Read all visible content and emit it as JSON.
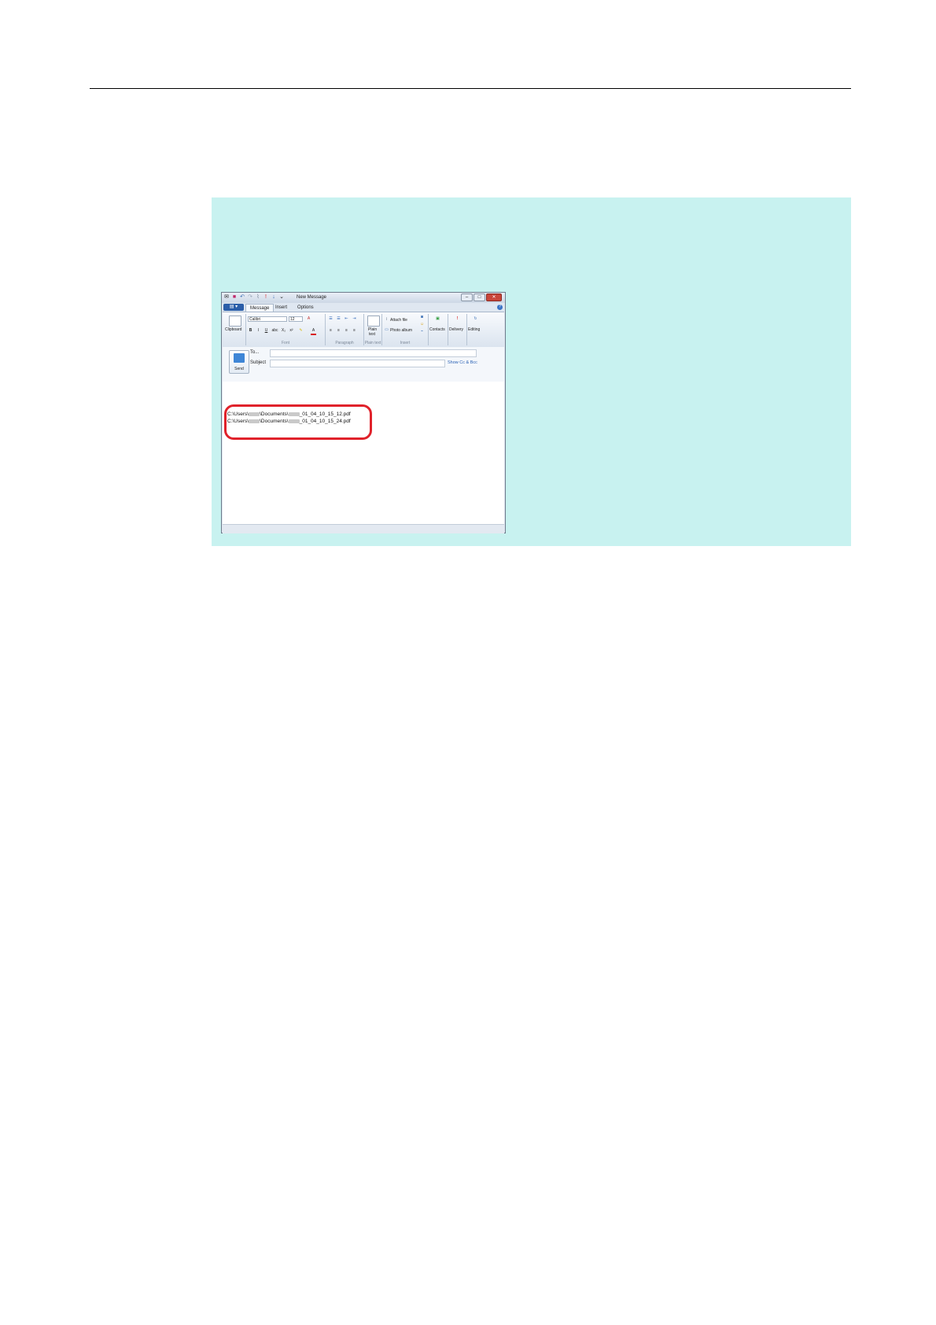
{
  "window": {
    "title": "New Message",
    "tabs": [
      "Message",
      "Insert",
      "Options"
    ],
    "ribbon": {
      "clipboard": {
        "button": "Clipboard"
      },
      "font": {
        "family": "Calibri",
        "size": "12",
        "group_label": "Font",
        "buttons": [
          "B",
          "I",
          "U",
          "abc",
          "X₂",
          "x²"
        ]
      },
      "paragraph": {
        "group_label": "Paragraph"
      },
      "plain_text": {
        "button_line1": "Plain",
        "button_line2": "text",
        "group_label": "Plain text"
      },
      "insert": {
        "attach_file": "Attach file",
        "photo_album": "Photo album",
        "group_label": "Insert"
      },
      "contacts": "Contacts",
      "delivery": "Delivery",
      "editing": "Editing"
    },
    "send_button": "Send",
    "to_label": "To...",
    "subject_label": "Subject",
    "show_cc_bcc": "Show Cc & Bcc",
    "attachments": [
      {
        "prefix": "C:\\Users\\",
        "middle": "\\Documents\\",
        "suffix": "_01_04_10_15_12.pdf"
      },
      {
        "prefix": "C:\\Users\\",
        "middle": "\\Documents\\",
        "suffix": "_01_04_10_15_24.pdf"
      }
    ]
  }
}
